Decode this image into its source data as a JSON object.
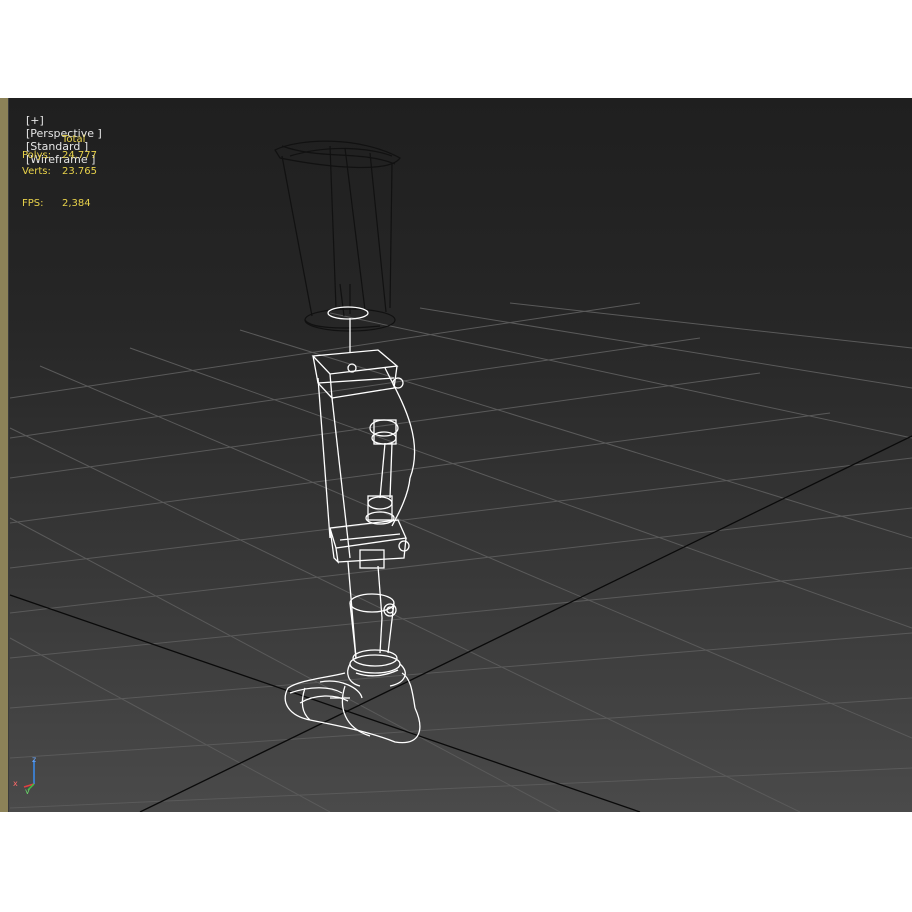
{
  "viewport_label": {
    "plus": "[+]",
    "view": "[Perspective ]",
    "shading": "[Standard ]",
    "mode": "[Wireframe ]"
  },
  "stats": {
    "header": "Total",
    "polys_label": "Polys:",
    "polys_value": "24.777",
    "verts_label": "Verts:",
    "verts_value": "23.765",
    "fps_label": "FPS:",
    "fps_value": "2,384"
  },
  "gizmo": {
    "z": "z",
    "x": "x",
    "y": "y"
  },
  "colors": {
    "stats_text": "#e8d24a",
    "label_text": "#e6e6e6",
    "grid": "#5a5a5a",
    "grid_axis": "#0a0a0a",
    "wire_selected": "#ffffff",
    "wire_unselected": "#111111"
  }
}
